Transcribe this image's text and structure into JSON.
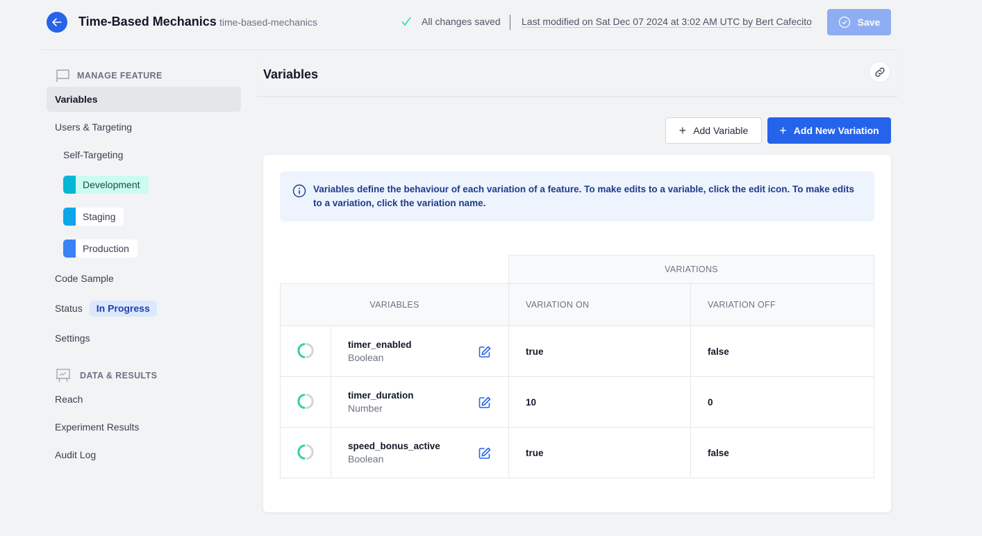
{
  "header": {
    "feature_title": "Time-Based Mechanics",
    "feature_key": "time-based-mechanics",
    "save_status": "All changes saved",
    "last_modified": "Last modified on Sat Dec 07 2024 at 3:02 AM UTC by Bert Cafecito",
    "save_label": "Save"
  },
  "sidebar": {
    "manage_section": "MANAGE FEATURE",
    "items": {
      "variables": "Variables",
      "users_targeting": "Users & Targeting",
      "self_targeting": "Self-Targeting",
      "code_sample": "Code Sample",
      "status_label": "Status",
      "status_value": "In Progress",
      "settings": "Settings"
    },
    "environments": [
      {
        "label": "Development",
        "color": "#06b6d4",
        "bg": "#ccfbf1"
      },
      {
        "label": "Staging",
        "color": "#0ea5e9",
        "bg": "#ffffff"
      },
      {
        "label": "Production",
        "color": "#3b82f6",
        "bg": "#ffffff"
      }
    ],
    "data_section": "DATA & RESULTS",
    "data_items": {
      "reach": "Reach",
      "experiment_results": "Experiment Results",
      "audit_log": "Audit Log"
    }
  },
  "main": {
    "title": "Variables",
    "add_variable_label": "Add Variable",
    "add_variation_label": "Add New Variation",
    "info_text": "Variables define the behaviour of each variation of a feature. To make edits to a variable, click the edit icon. To make edits to a variation, click the variation name.",
    "table": {
      "group_header": "VARIATIONS",
      "variables_header": "VARIABLES",
      "columns": [
        "VARIATION ON",
        "VARIATION OFF"
      ],
      "rows": [
        {
          "name": "timer_enabled",
          "type": "Boolean",
          "values": [
            "true",
            "false"
          ]
        },
        {
          "name": "timer_duration",
          "type": "Number",
          "values": [
            "10",
            "0"
          ]
        },
        {
          "name": "speed_bonus_active",
          "type": "Boolean",
          "values": [
            "true",
            "false"
          ]
        }
      ]
    }
  },
  "colors": {
    "primary": "#2563eb",
    "save_disabled": "#8fadf2",
    "saved_check": "#2dd4bf",
    "status_green": "#34d399"
  }
}
